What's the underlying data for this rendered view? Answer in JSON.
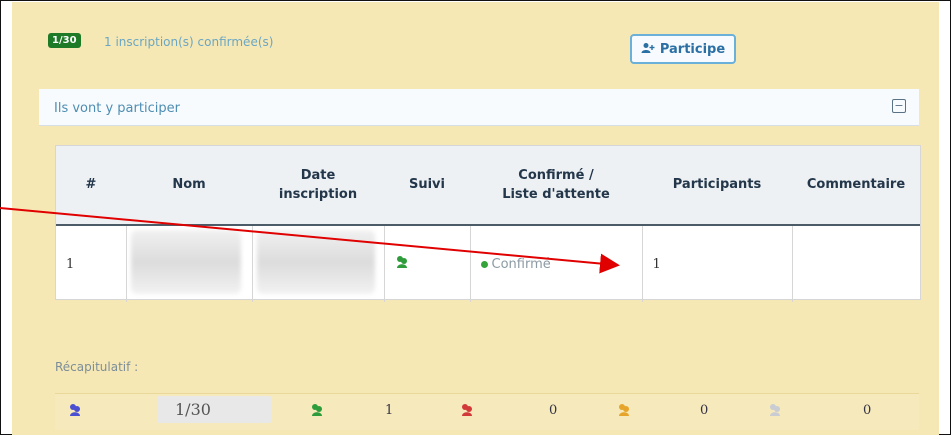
{
  "header": {
    "badge": "1/30",
    "confirmed_text": "1 inscription(s) confirmée(s)",
    "participate_button": "Participe"
  },
  "section": {
    "title": "Ils vont y participer",
    "toggle": "−"
  },
  "table": {
    "headers": [
      [
        "#"
      ],
      [
        "Nom"
      ],
      [
        "Date",
        "inscription"
      ],
      [
        "Suivi"
      ],
      [
        "Confirmé /",
        "Liste d'attente"
      ],
      [
        "Participants"
      ],
      [
        "Commentaire"
      ]
    ],
    "rows": [
      {
        "index": "1",
        "status": "Confirmé",
        "participants": "1",
        "comment": ""
      }
    ]
  },
  "recap": {
    "label": "Récapitulatif :",
    "total": "1/30",
    "green": "1",
    "red": "0",
    "orange": "0",
    "grey": "0"
  },
  "colors": {
    "panel": "#f6e8b5",
    "badge": "#1f7a28",
    "accent_blue": "#2b6fa3",
    "arrow_red": "#e00000"
  }
}
